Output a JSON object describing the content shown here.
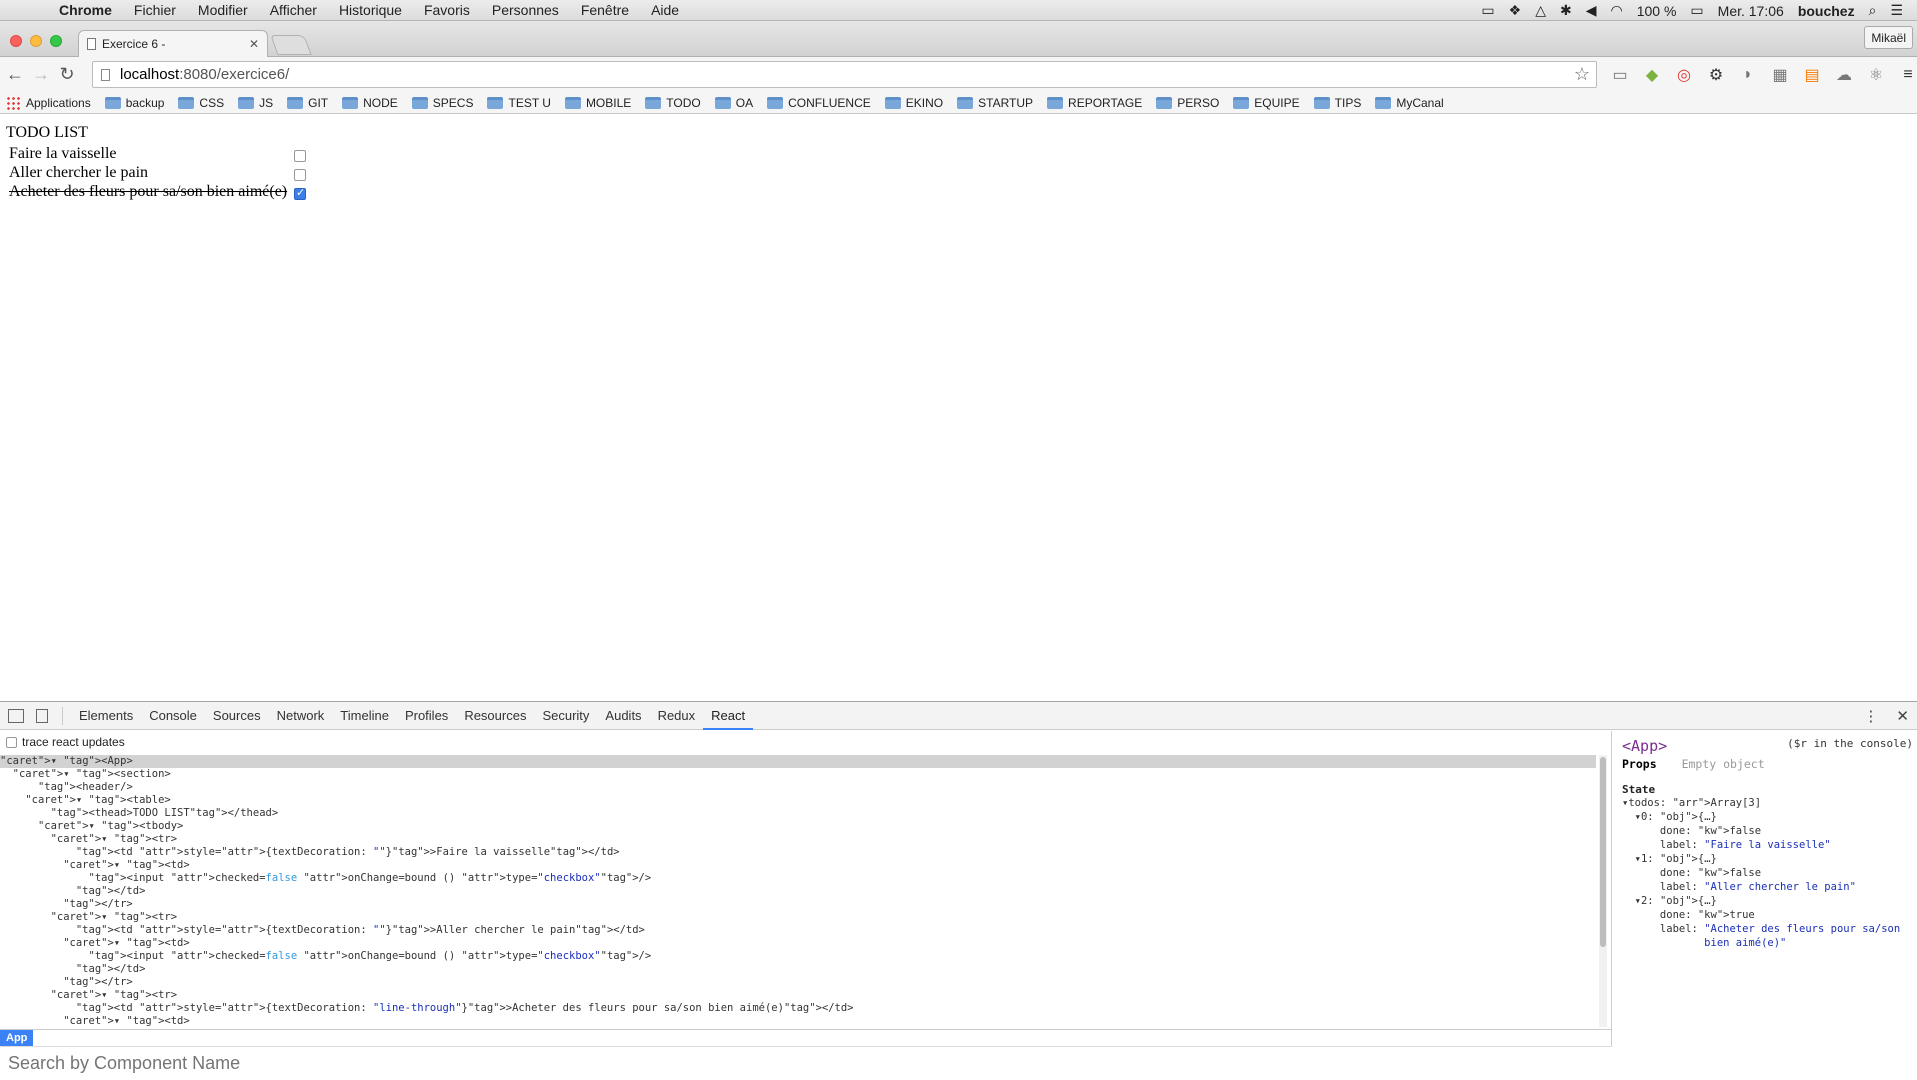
{
  "menubar": {
    "app": "Chrome",
    "menus": [
      "Fichier",
      "Modifier",
      "Afficher",
      "Historique",
      "Favoris",
      "Personnes",
      "Fenêtre",
      "Aide"
    ],
    "battery": "100 %",
    "clock": "Mer. 17:06",
    "user": "bouchez"
  },
  "tab": {
    "title": "Exercice 6 -"
  },
  "profile": "Mikaël",
  "address": {
    "host": "localhost",
    "rest": ":8080/exercice6/"
  },
  "bookmarks": [
    "Applications",
    "backup",
    "CSS",
    "JS",
    "GIT",
    "NODE",
    "SPECS",
    "TEST U",
    "MOBILE",
    "TODO",
    "OA",
    "CONFLUENCE",
    "EKINO",
    "STARTUP",
    "REPORTAGE",
    "PERSO",
    "EQUIPE",
    "TIPS",
    "MyCanal"
  ],
  "page": {
    "title": "TODO LIST",
    "todos": [
      {
        "label": "Faire la vaisselle",
        "done": false
      },
      {
        "label": "Aller chercher le pain",
        "done": false
      },
      {
        "label": "Acheter des fleurs pour sa/son bien aimé(e)",
        "done": true
      }
    ]
  },
  "devtools": {
    "tabs": [
      "Elements",
      "Console",
      "Sources",
      "Network",
      "Timeline",
      "Profiles",
      "Resources",
      "Security",
      "Audits",
      "Redux",
      "React"
    ],
    "active_tab": "React",
    "trace_label": "trace react updates",
    "tree": [
      "▾ <App>",
      "  ▾ <section>",
      "      <header/>",
      "    ▾ <table>",
      "        <thead>TODO LIST</thead>",
      "      ▾ <tbody>",
      "        ▾ <tr>",
      "            <td style={textDecoration: \"\"}>Faire la vaisselle</td>",
      "          ▾ <td>",
      "              <input checked=false onChange=bound () type=\"checkbox\"/>",
      "            </td>",
      "          </tr>",
      "        ▾ <tr>",
      "            <td style={textDecoration: \"\"}>Aller chercher le pain</td>",
      "          ▾ <td>",
      "              <input checked=false onChange=bound () type=\"checkbox\"/>",
      "            </td>",
      "          </tr>",
      "        ▾ <tr>",
      "            <td style={textDecoration: \"line-through\"}>Acheter des fleurs pour sa/son bien aimé(e)</td>",
      "          ▾ <td>"
    ],
    "breadcrumb": "App",
    "search_placeholder": "Search by Component Name",
    "side": {
      "component": "<App>",
      "console_hint": "($r in the console)",
      "props_label": "Props",
      "props_empty": "Empty object",
      "state_label": "State",
      "state_lines": [
        "▾todos: Array[3]",
        "  ▾0: {…}",
        "      done: false",
        "      label: \"Faire la vaisselle\"",
        "  ▾1: {…}",
        "      done: false",
        "      label: \"Aller chercher le pain\"",
        "  ▾2: {…}",
        "      done: true",
        "      label: \"Acheter des fleurs pour sa/son",
        "             bien aimé(e)\""
      ]
    }
  }
}
